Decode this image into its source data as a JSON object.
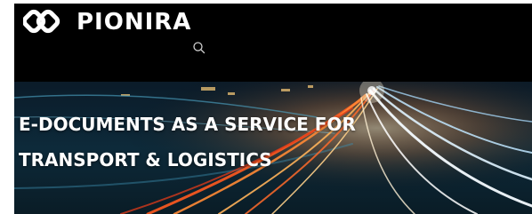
{
  "header": {
    "brand_name": "PIONIRA",
    "logo_icon": "infinity-knot-logo-icon",
    "search_icon": "search-icon"
  },
  "hero": {
    "title_line_1": "E-DOCUMENTS AS A SERVICE FOR",
    "title_line_2": "TRANSPORT & LOGISTICS",
    "background": "night-highway-light-trails"
  },
  "colors": {
    "header_bg": "#000000",
    "text": "#ffffff",
    "light_trail_warm": "#ff7a2a",
    "light_trail_cool": "#bfe6ff"
  }
}
